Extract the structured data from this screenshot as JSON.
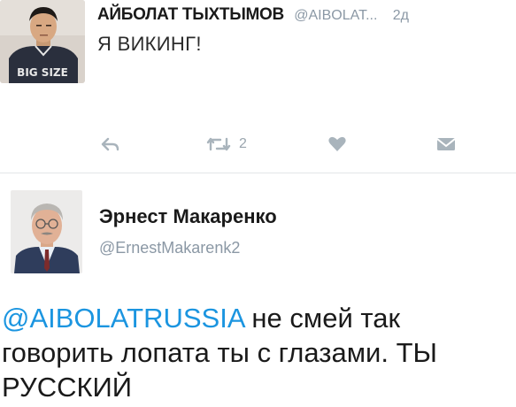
{
  "tweet1": {
    "author_name": "АЙБОЛАТ ТЫХТЫМОВ",
    "handle": "@AIBOLAT...",
    "time": "2д",
    "text": "Я ВИКИНГ!",
    "retweet_count": "2",
    "icons": {
      "reply": "reply-arrow-icon",
      "retweet": "retweet-icon",
      "like": "heart-icon",
      "message": "envelope-icon"
    },
    "avatar_shirt_text": "BIG SIZE"
  },
  "tweet2": {
    "author_name": "Эрнест Макаренко",
    "handle": "@ErnestMakarenk2",
    "mention": "@AIBOLATRUSSIA",
    "text_line1_rest": " не смей так",
    "text_line2": "говорить лопата ты с глазами.  ТЫ",
    "text_line3": "РУССКИЙ"
  },
  "colors": {
    "link": "#1b95e0",
    "muted": "#8b98a5",
    "icon": "#a9b4bc",
    "divider": "#e3e6e8"
  }
}
